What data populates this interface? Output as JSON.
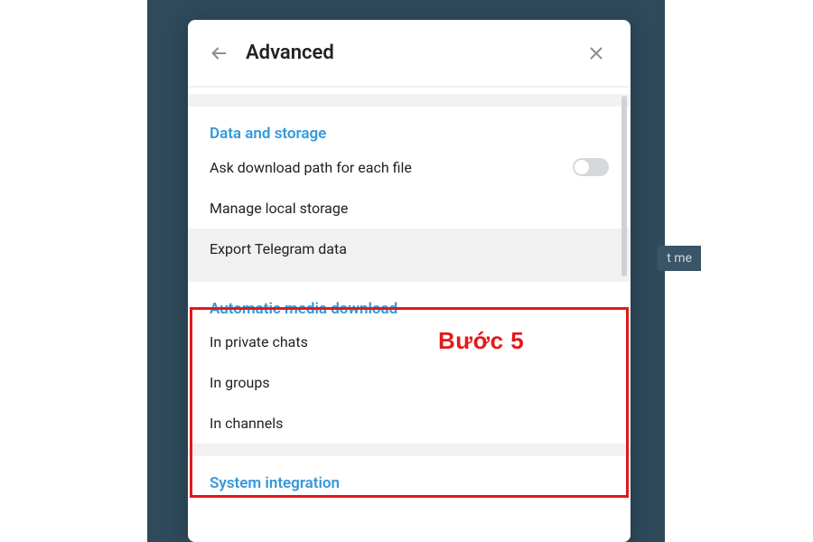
{
  "header": {
    "title": "Advanced"
  },
  "bg_tag": "t me",
  "sections": {
    "data_storage": {
      "title": "Data and storage",
      "ask_download_path": "Ask download path for each file",
      "manage_local_storage": "Manage local storage",
      "export_telegram_data": "Export Telegram data"
    },
    "auto_media": {
      "title": "Automatic media download",
      "in_private_chats": "In private chats",
      "in_groups": "In groups",
      "in_channels": "In channels"
    },
    "system_integration": {
      "title": "System integration"
    }
  },
  "annotation": {
    "label": "Bước 5"
  }
}
